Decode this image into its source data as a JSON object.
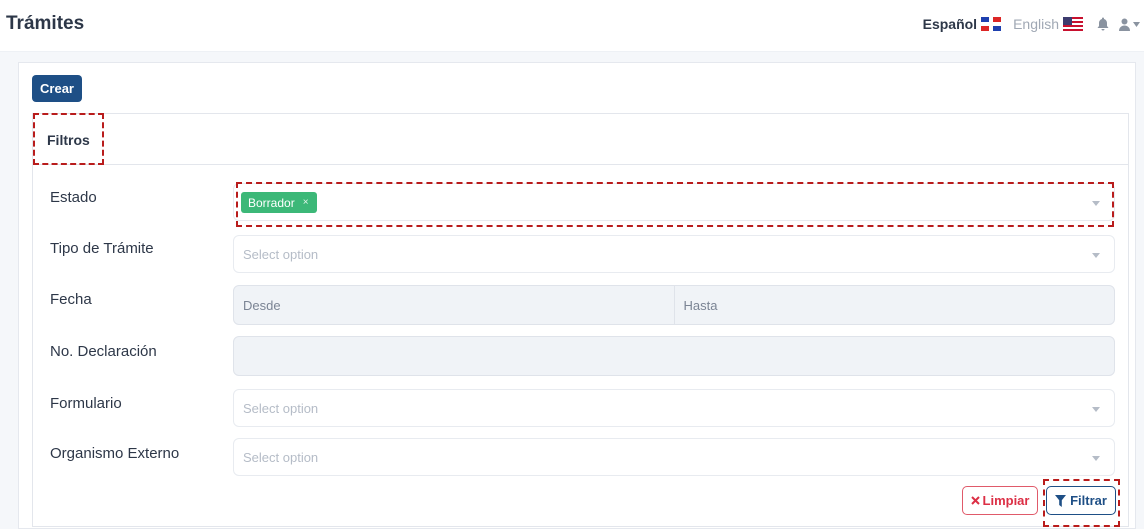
{
  "header": {
    "title": "Trámites",
    "languages": [
      {
        "label": "Español",
        "flag": "dominican-republic-flag",
        "active": true
      },
      {
        "label": "English",
        "flag": "us-flag",
        "active": false
      }
    ]
  },
  "toolbar": {
    "create_label": "Crear"
  },
  "filters": {
    "title": "Filtros",
    "fields": {
      "estado": {
        "label": "Estado",
        "selected_tag": "Borrador",
        "tag_remove": "×"
      },
      "tipo": {
        "label": "Tipo de Trámite",
        "placeholder": "Select option"
      },
      "fecha": {
        "label": "Fecha",
        "from_placeholder": "Desde",
        "to_placeholder": "Hasta"
      },
      "declaracion": {
        "label": "No. Declaración",
        "value": ""
      },
      "formulario": {
        "label": "Formulario",
        "placeholder": "Select option"
      },
      "organismo": {
        "label": "Organismo Externo",
        "placeholder": "Select option"
      }
    },
    "actions": {
      "clear_label": "Limpiar",
      "filter_label": "Filtrar"
    }
  },
  "colors": {
    "primary": "#1e4f86",
    "tag_green": "#3cb878",
    "danger": "#dc2f45",
    "highlight": "#b91c1c"
  }
}
